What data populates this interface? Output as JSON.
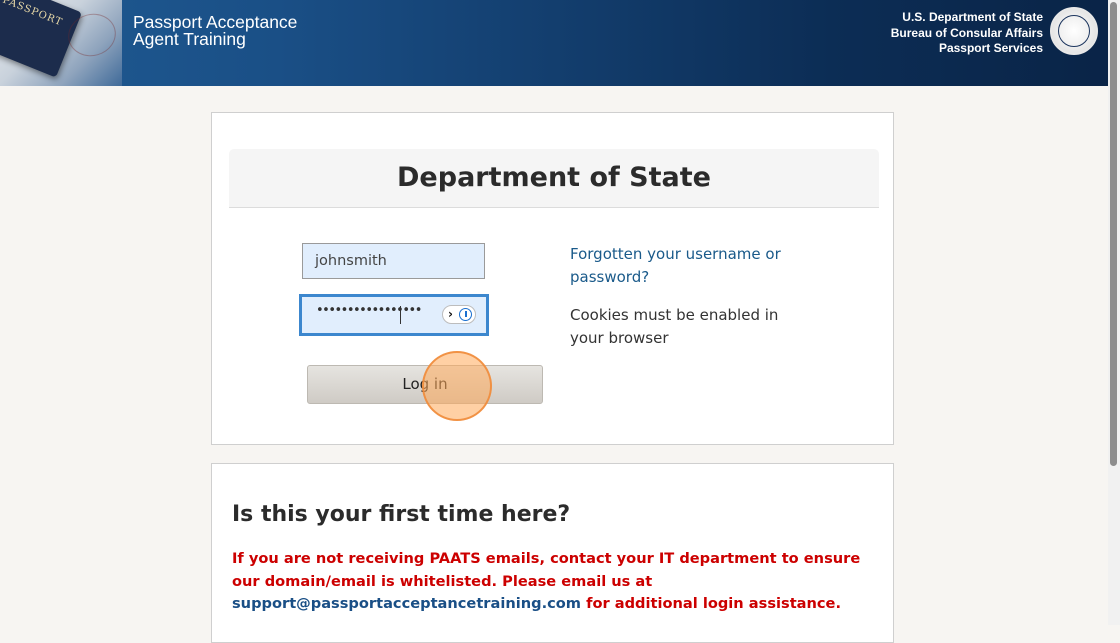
{
  "header": {
    "title_line1": "Passport Acceptance",
    "title_line2": "Agent Training",
    "agency_line1": "U.S. Department of State",
    "agency_line2": "Bureau of Consular Affairs",
    "agency_line3": "Passport Services",
    "passport_text": "PASSPORT",
    "seal_icon": "department-of-state-seal",
    "gradient_start": "#1f5a92",
    "gradient_end": "#0a2447"
  },
  "login": {
    "title": "Department of State",
    "username_value": "johnsmith",
    "password_mask": "•••••••••••••••••",
    "password_manager_icon": "password-manager-icon",
    "login_label": "Log in",
    "forgot_link": "Forgotten your username or password?",
    "cookies_note": "Cookies must be enabled in your browser"
  },
  "first_time": {
    "title": "Is this your first time here?",
    "notice_part1": "If you are not receiving PAATS emails, contact your IT department to ensure our domain/email is whitelisted. Please email us at",
    "support_email": "support@passportacceptancetraining.com",
    "notice_part2": "for additional login assistance."
  },
  "colors": {
    "accent_blue": "#3c87ce",
    "link": "#1a5a8a",
    "warning": "#cc0000"
  }
}
